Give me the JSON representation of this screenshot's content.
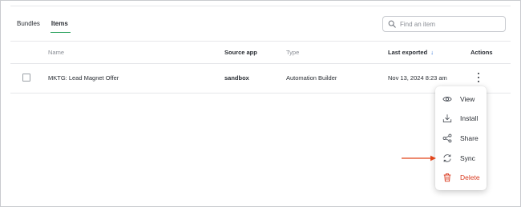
{
  "tabs": [
    {
      "label": "Bundles",
      "active": false
    },
    {
      "label": "Items",
      "active": true
    }
  ],
  "search": {
    "placeholder": "Find an item",
    "value": ""
  },
  "table": {
    "columns": {
      "name": "Name",
      "source_app": "Source app",
      "type": "Type",
      "last_exported": "Last exported",
      "actions": "Actions"
    },
    "sort": {
      "column": "last_exported",
      "direction": "descending"
    },
    "rows": [
      {
        "name": "MKTG: Lead Magnet Offer",
        "source_app": "sandbox",
        "type": "Automation Builder",
        "last_exported": "Nov 13, 2024 8:23 am",
        "checked": false
      }
    ]
  },
  "menu": {
    "items": [
      {
        "label": "View",
        "icon": "eye-icon"
      },
      {
        "label": "Install",
        "icon": "download-icon"
      },
      {
        "label": "Share",
        "icon": "share-icon"
      },
      {
        "label": "Sync",
        "icon": "sync-icon",
        "highlighted": true
      },
      {
        "label": "Delete",
        "icon": "trash-icon",
        "danger": true
      }
    ]
  },
  "colors": {
    "accent_tab_underline": "#1f9d55",
    "sort_arrow": "#2f6fd6",
    "danger": "#d93a1f",
    "annotation_arrow": "#e2461b"
  }
}
